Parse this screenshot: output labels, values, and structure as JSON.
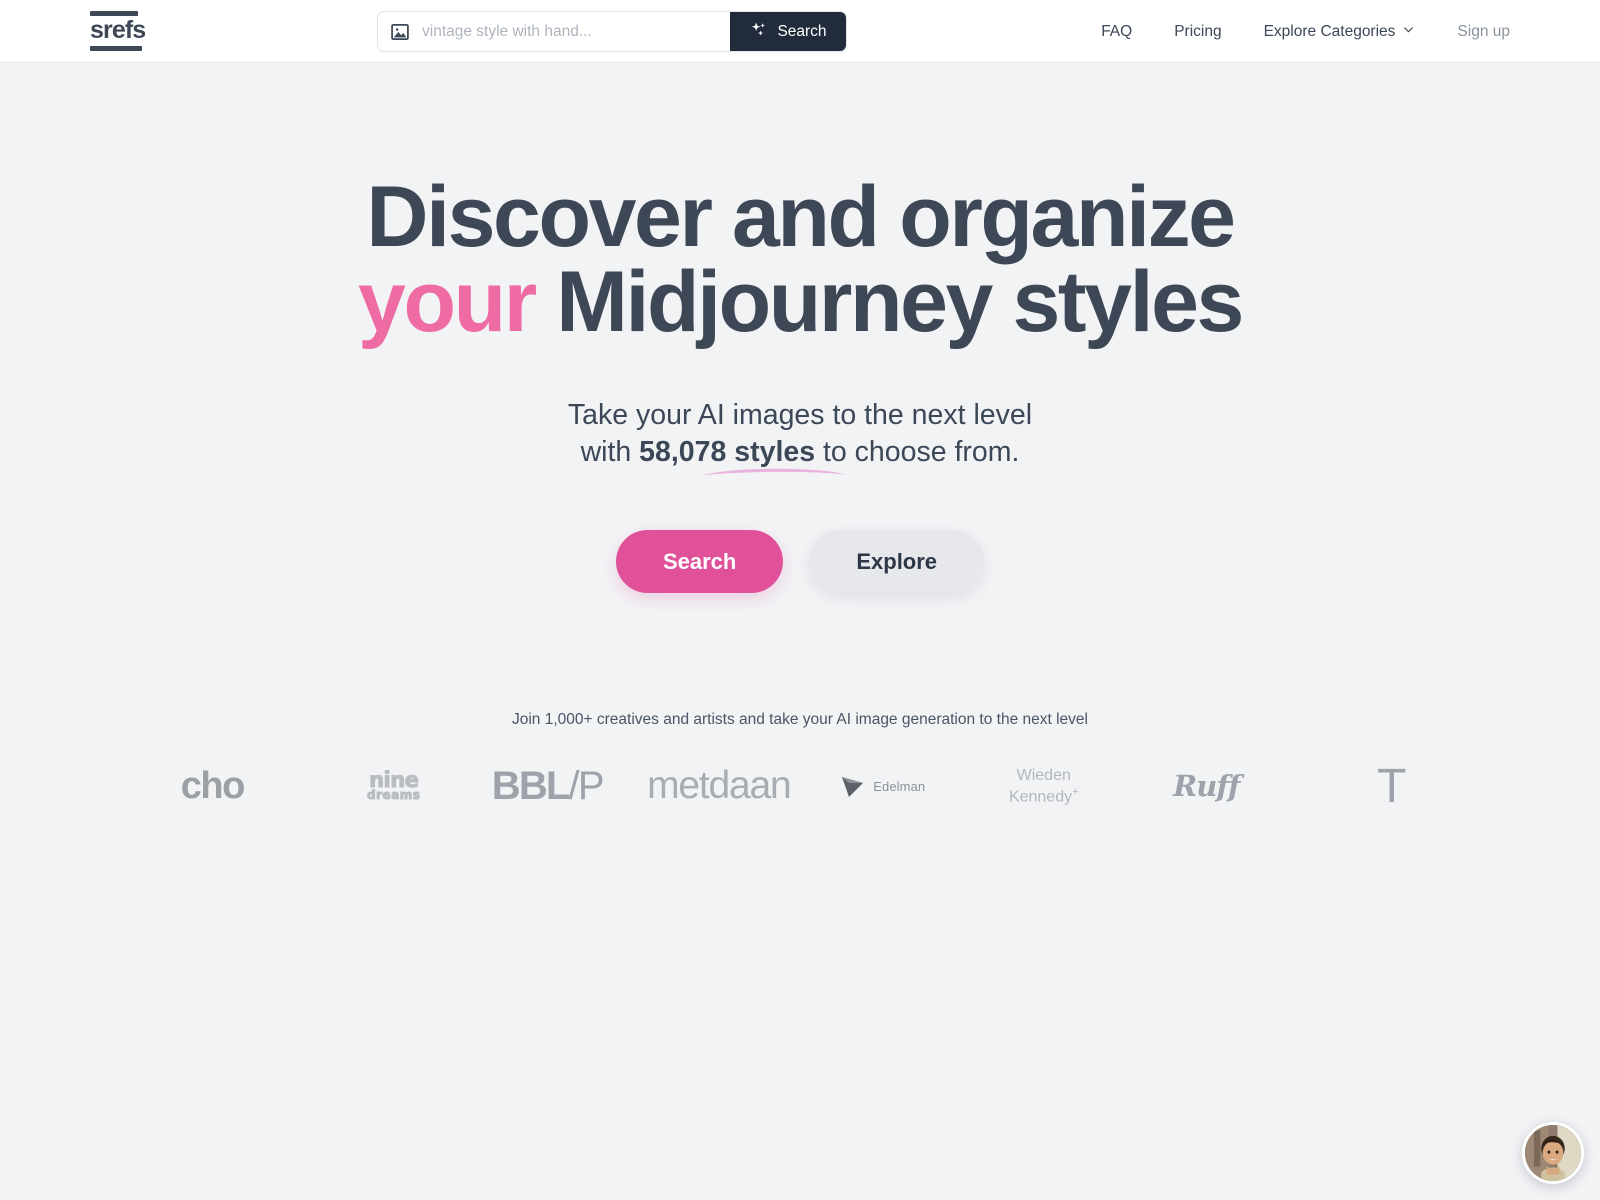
{
  "header": {
    "logo": {
      "word": "srefs",
      "icon": "srefs-logo"
    },
    "search": {
      "placeholder": "vintage style with hand...",
      "value": "",
      "image_icon": "image-icon",
      "button_label": "Search",
      "button_icon": "sparkles-icon"
    },
    "nav": [
      {
        "label": "FAQ",
        "icon": null,
        "muted": false
      },
      {
        "label": "Pricing",
        "icon": null,
        "muted": false
      },
      {
        "label": "Explore Categories",
        "icon": "chevron-down-icon",
        "muted": false
      },
      {
        "label": "Sign up",
        "icon": null,
        "muted": true
      }
    ]
  },
  "hero": {
    "headline": {
      "line1": "Discover and organize",
      "accent": "your",
      "line2_rest": " Midjourney",
      "line3": "styles"
    },
    "subhead": {
      "prefix": "Take your AI images to the next level",
      "line2_prefix": "with ",
      "highlight": "58,078 styles",
      "line2_suffix": " to choose from."
    },
    "buttons": [
      {
        "label": "Search",
        "style": "primary"
      },
      {
        "label": "Explore",
        "style": "secondary"
      }
    ]
  },
  "social_proof": {
    "text": "Join 1,000+ creatives and artists and take your AI image generation to the next level",
    "logos": [
      {
        "name": "icho",
        "display": "cho",
        "type": "wordmark-cropped"
      },
      {
        "name": "nine-dreams",
        "display": "nine",
        "display2": "dreams",
        "type": "wordmark"
      },
      {
        "name": "bbl-p",
        "display_bold": "BBL",
        "display_thin": "/P",
        "type": "wordmark-cropped"
      },
      {
        "name": "metdaan",
        "display": "metdaan",
        "type": "wordmark"
      },
      {
        "name": "edelman",
        "display": "Edelman",
        "type": "logo-with-mark"
      },
      {
        "name": "wieden-kennedy",
        "display": "Wieden",
        "display2": "Kennedy",
        "sup": "+",
        "type": "wordmark"
      },
      {
        "name": "ruff",
        "display": "Ruff",
        "type": "script-wordmark"
      },
      {
        "name": "t-brand",
        "display": "T",
        "type": "wordmark-cropped"
      }
    ]
  },
  "chat_widget": {
    "name": "support-avatar",
    "alt": "support agent photo"
  },
  "colors": {
    "page_bg": "#f2f3f5",
    "header_bg": "#ffffff",
    "text_dark": "#3d4756",
    "accent_pink": "#ee6ca3",
    "button_pink": "#e0519a",
    "button_gray": "#e7e8ec",
    "search_btn_dark": "#212b3b",
    "logo_gray": "#9ea3ab",
    "underline_pink": "#efa8d4"
  }
}
